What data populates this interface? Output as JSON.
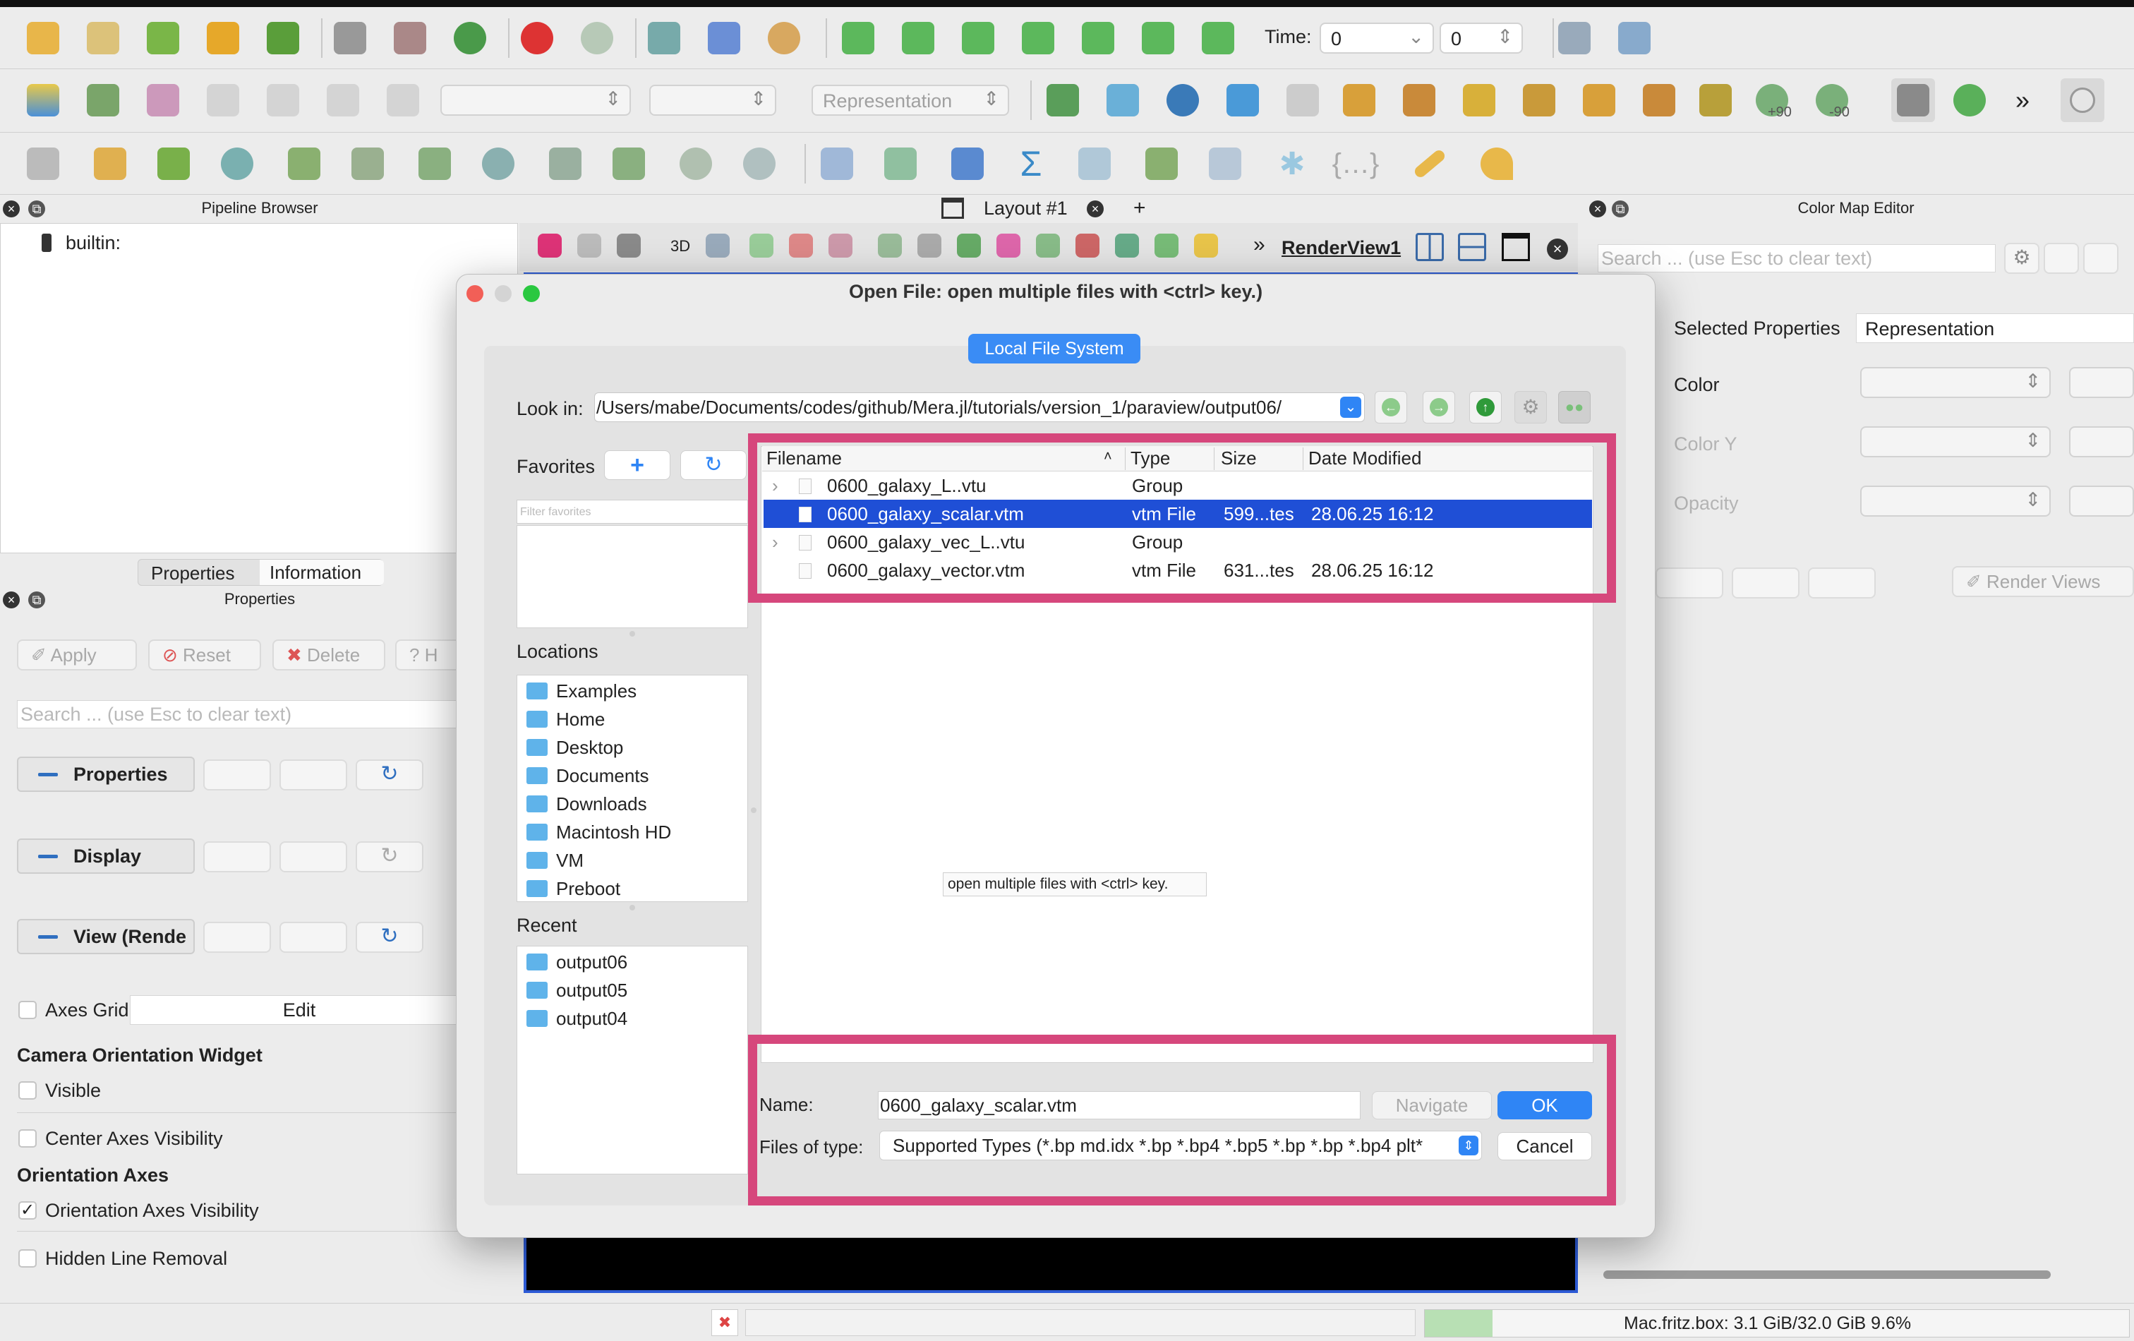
{
  "toolbar_time": {
    "label": "Time:",
    "time_value": "0",
    "step_value": "0"
  },
  "toolbar_combo": {
    "representation": "Representation"
  },
  "toolbar_views": {
    "rot_plus": "+90",
    "rot_minus": "-90"
  },
  "pipeline": {
    "title": "Pipeline Browser",
    "root": "builtin:"
  },
  "layout": {
    "tab_label": "Layout #1",
    "add_tab": "+",
    "view_3d": "3D",
    "render_view": "RenderView1"
  },
  "props_tabs": {
    "properties": "Properties",
    "information": "Information"
  },
  "props": {
    "title": "Properties",
    "apply": "Apply",
    "reset": "Reset",
    "delete": "Delete",
    "help": "H",
    "search_placeholder": "Search ... (use Esc to clear text)",
    "sec_properties": "Properties",
    "sec_display": "Display",
    "sec_view": "View (Rende",
    "axes_grid": "Axes Grid",
    "edit": "Edit",
    "camera_widget": "Camera Orientation Widget",
    "visible": "Visible",
    "center_axes": "Center Axes Visibility",
    "orientation_axes": "Orientation Axes",
    "orientation_axes_vis": "Orientation Axes Visibility",
    "hidden_line": "Hidden Line Removal"
  },
  "cme": {
    "title": "Color Map Editor",
    "search_placeholder": "Search ... (use Esc to clear text)",
    "selected_props": "Selected Properties",
    "selected_value": "Representation",
    "color": "Color",
    "color_y": "Color Y",
    "opacity": "Opacity",
    "render_views": "Render Views"
  },
  "dialog": {
    "title": "Open File:  open multiple files with <ctrl> key.)",
    "fs_tab": "Local File System",
    "look_in_label": "Look in:",
    "look_in_path": "/Users/mabe/Documents/codes/github/Mera.jl/tutorials/version_1/paraview/output06/",
    "favorites": "Favorites",
    "filter_favorites": "Filter favorites",
    "locations_label": "Locations",
    "locations": [
      "Examples",
      "Home",
      "Desktop",
      "Documents",
      "Downloads",
      "Macintosh HD",
      "VM",
      "Preboot"
    ],
    "recent_label": "Recent",
    "recent": [
      "output06",
      "output05",
      "output04"
    ],
    "columns": {
      "filename": "Filename",
      "type": "Type",
      "size": "Size",
      "date": "Date Modified"
    },
    "files": [
      {
        "name": "0600_galaxy_L..vtu",
        "type": "Group",
        "size": "",
        "date": ""
      },
      {
        "name": "0600_galaxy_scalar.vtm",
        "type": "vtm File",
        "size": "599...tes",
        "date": "28.06.25 16:12"
      },
      {
        "name": "0600_galaxy_vec_L..vtu",
        "type": "Group",
        "size": "",
        "date": ""
      },
      {
        "name": "0600_galaxy_vector.vtm",
        "type": "vtm File",
        "size": "631...tes",
        "date": "28.06.25 16:12"
      }
    ],
    "tooltip": "open multiple files with <ctrl> key.",
    "name_label": "Name:",
    "name_value": "0600_galaxy_scalar.vtm",
    "navigate": "Navigate",
    "ok": "OK",
    "files_of_type_label": "Files of type:",
    "files_of_type_value": "Supported Types (*.bp md.idx *.bp *.bp4 *.bp5 *.bp *.bp *.bp4 plt*",
    "cancel": "Cancel"
  },
  "statusbar": {
    "memory": "Mac.fritz.box: 3.1 GiB/32.0 GiB 9.6%"
  },
  "colors": {
    "highlight": "#d6477c",
    "accent": "#2f6fc0",
    "selection": "#1f4fd6",
    "ok_button": "#2f85f5"
  }
}
